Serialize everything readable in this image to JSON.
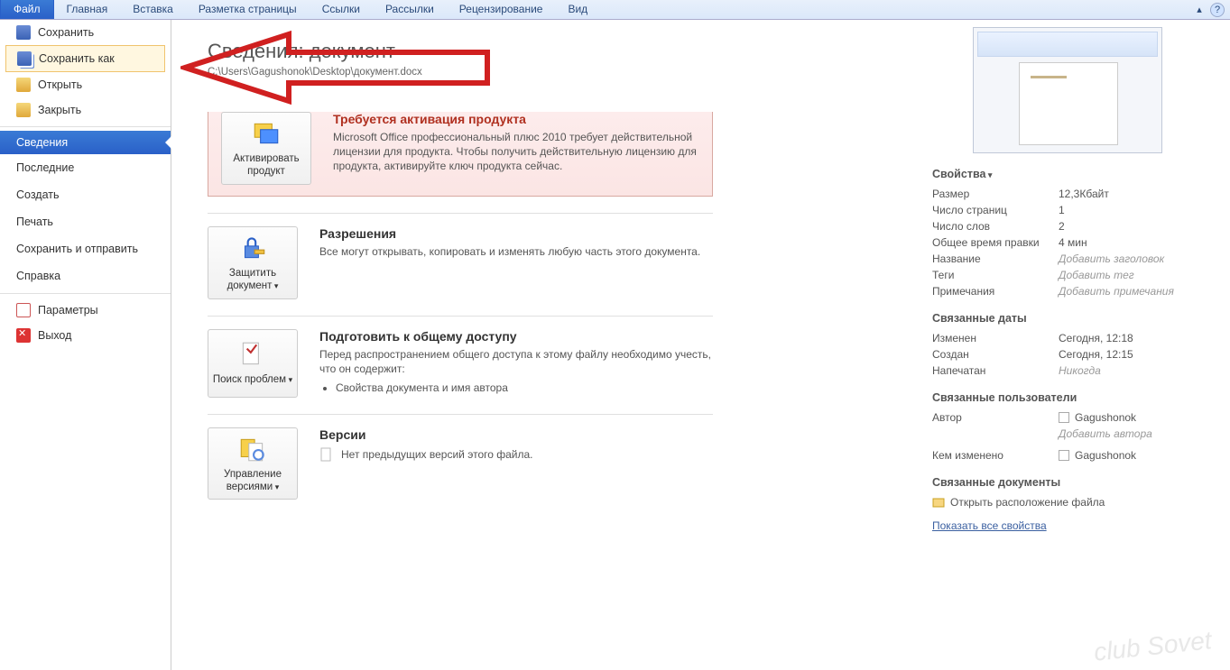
{
  "ribbon": {
    "tabs": [
      "Файл",
      "Главная",
      "Вставка",
      "Разметка страницы",
      "Ссылки",
      "Рассылки",
      "Рецензирование",
      "Вид"
    ],
    "activeIndex": 0
  },
  "sidebar": {
    "save": "Сохранить",
    "saveAs": "Сохранить как",
    "open": "Открыть",
    "close": "Закрыть",
    "info": "Сведения",
    "recent": "Последние",
    "new": "Создать",
    "print": "Печать",
    "saveSend": "Сохранить и отправить",
    "help": "Справка",
    "options": "Параметры",
    "exit": "Выход"
  },
  "header": {
    "title": "Сведения: документ",
    "path": "C:\\Users\\Gagushonok\\Desktop\\документ.docx"
  },
  "activation": {
    "button": "Активировать продукт",
    "title": "Требуется активация продукта",
    "text": "Microsoft Office профессиональный плюс 2010 требует действительной лицензии для продукта. Чтобы получить действительную лицензию для продукта, активируйте ключ продукта сейчас."
  },
  "permissions": {
    "button": "Защитить документ",
    "title": "Разрешения",
    "text": "Все могут открывать, копировать и изменять любую часть этого документа."
  },
  "prepare": {
    "button": "Поиск проблем",
    "title": "Подготовить к общему доступу",
    "text": "Перед распространением общего доступа к этому файлу необходимо учесть, что он содержит:",
    "items": [
      "Свойства документа и имя автора"
    ]
  },
  "versions": {
    "button": "Управление версиями",
    "title": "Версии",
    "text": "Нет предыдущих версий этого файла."
  },
  "props": {
    "heading": "Свойства",
    "rows": [
      {
        "k": "Размер",
        "v": "12,3Кбайт"
      },
      {
        "k": "Число страниц",
        "v": "1"
      },
      {
        "k": "Число слов",
        "v": "2"
      },
      {
        "k": "Общее время правки",
        "v": "4 мин"
      },
      {
        "k": "Название",
        "v": "Добавить заголовок",
        "gray": true
      },
      {
        "k": "Теги",
        "v": "Добавить тег",
        "gray": true
      },
      {
        "k": "Примечания",
        "v": "Добавить примечания",
        "gray": true
      }
    ],
    "datesHeading": "Связанные даты",
    "dates": [
      {
        "k": "Изменен",
        "v": "Сегодня, 12:18"
      },
      {
        "k": "Создан",
        "v": "Сегодня, 12:15"
      },
      {
        "k": "Напечатан",
        "v": "Никогда",
        "gray": true
      }
    ],
    "usersHeading": "Связанные пользователи",
    "author": {
      "label": "Автор",
      "name": "Gagushonok",
      "add": "Добавить автора"
    },
    "changedBy": {
      "label": "Кем изменено",
      "name": "Gagushonok"
    },
    "docsHeading": "Связанные документы",
    "openLocation": "Открыть расположение файла",
    "showAll": "Показать все свойства"
  },
  "watermark": "club Sovet"
}
